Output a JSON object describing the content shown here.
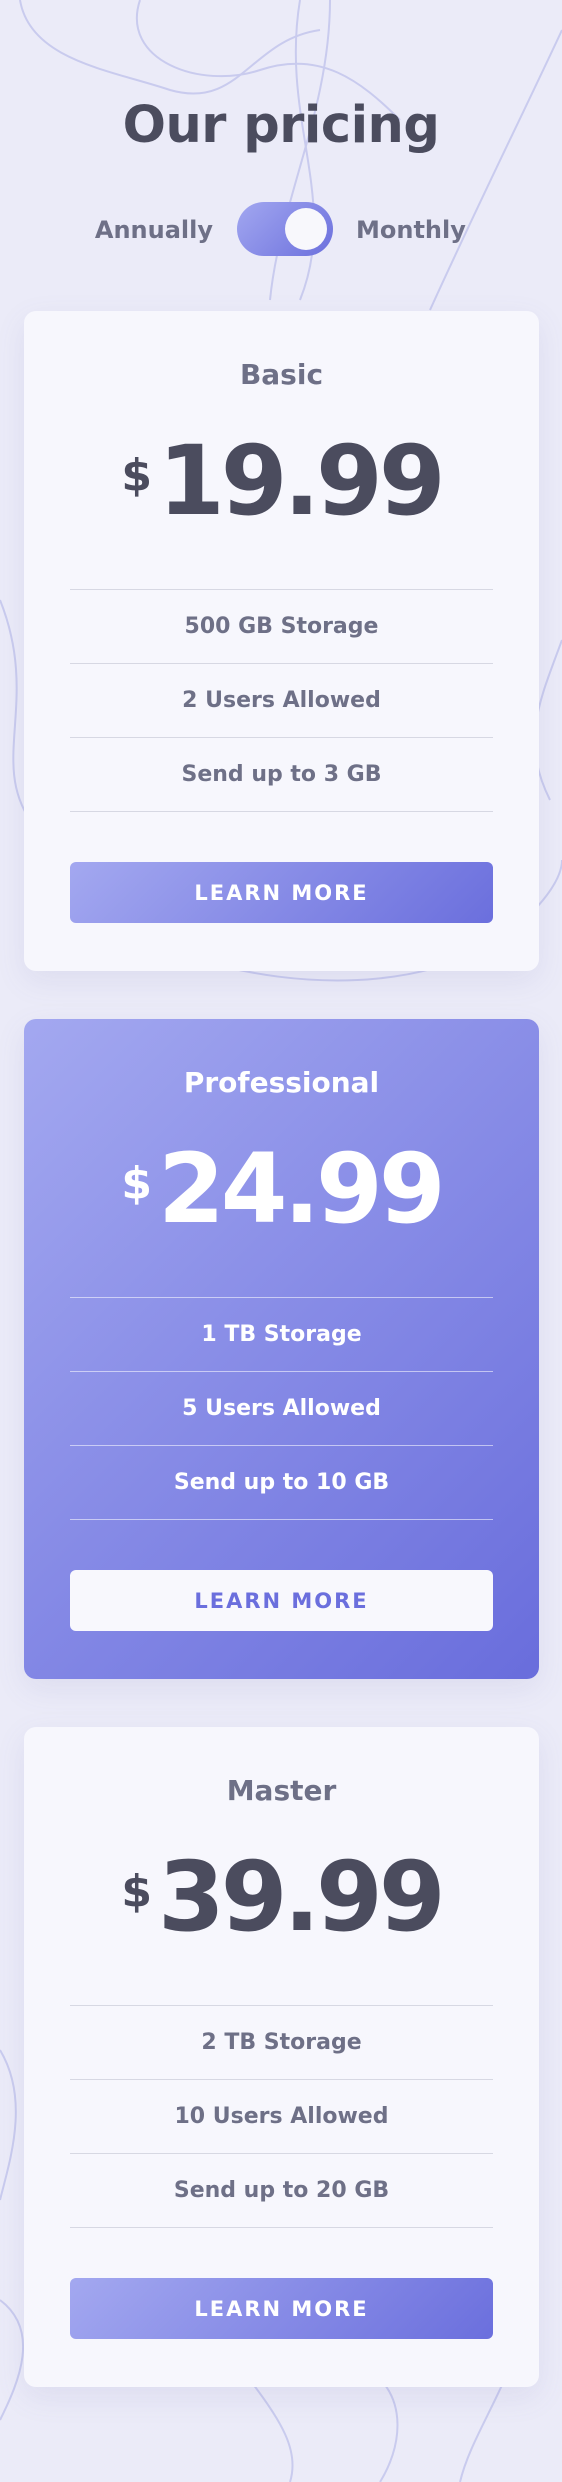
{
  "header": {
    "title": "Our pricing"
  },
  "billing_toggle": {
    "left_label": "Annually",
    "right_label": "Monthly",
    "selected": "Monthly"
  },
  "plans": [
    {
      "name": "Basic",
      "currency": "$",
      "price": "19.99",
      "features": [
        "500 GB Storage",
        "2 Users Allowed",
        "Send up to 3 GB"
      ],
      "button_label": "LEARN MORE",
      "featured": false
    },
    {
      "name": "Professional",
      "currency": "$",
      "price": "24.99",
      "features": [
        "1 TB Storage",
        "5 Users Allowed",
        "Send up to 10 GB"
      ],
      "button_label": "LEARN MORE",
      "featured": true
    },
    {
      "name": "Master",
      "currency": "$",
      "price": "39.99",
      "features": [
        "2 TB Storage",
        "10 Users Allowed",
        "Send up to 20 GB"
      ],
      "button_label": "LEARN MORE",
      "featured": false
    }
  ],
  "colors": {
    "page_background": "#ebebf8",
    "card_background": "#f7f7fd",
    "gradient_start": "#a3a8f0",
    "gradient_end": "#696ddc",
    "text_dark": "#4b4c5e",
    "text_muted": "#6e7087"
  }
}
